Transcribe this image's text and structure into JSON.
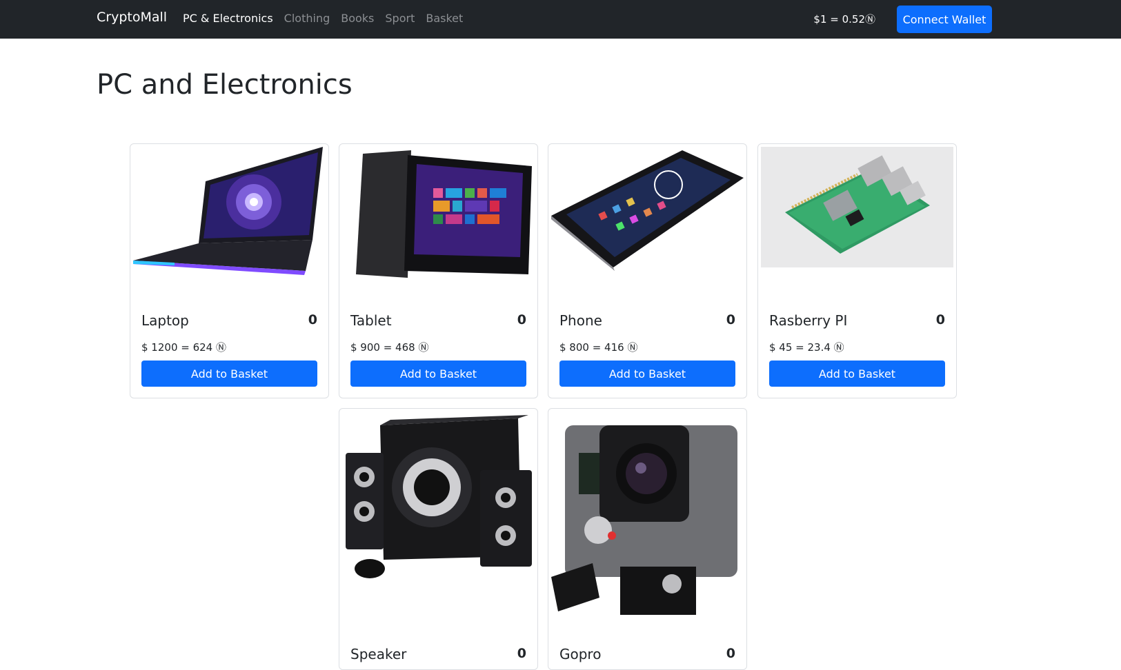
{
  "nav": {
    "brand": "CryptoMall",
    "links": [
      "PC & Electronics",
      "Clothing",
      "Books",
      "Sport",
      "Basket"
    ],
    "rate": "$1 = 0.52Ⓝ",
    "connect_label": "Connect Wallet"
  },
  "page": {
    "title": "PC and Electronics"
  },
  "products": [
    {
      "name": "Laptop",
      "count": "0",
      "price": "$ 1200 = 624 Ⓝ",
      "button": "Add to Basket"
    },
    {
      "name": "Tablet",
      "count": "0",
      "price": "$ 900 = 468 Ⓝ",
      "button": "Add to Basket"
    },
    {
      "name": "Phone",
      "count": "0",
      "price": "$ 800 = 416 Ⓝ",
      "button": "Add to Basket"
    },
    {
      "name": "Rasberry PI",
      "count": "0",
      "price": "$ 45 = 23.4 Ⓝ",
      "button": "Add to Basket"
    },
    {
      "name": "Speaker",
      "count": "0"
    },
    {
      "name": "Gopro",
      "count": "0"
    }
  ],
  "colors": {
    "navbar": "#212529",
    "primary": "#0d6efd",
    "text": "#212529"
  }
}
